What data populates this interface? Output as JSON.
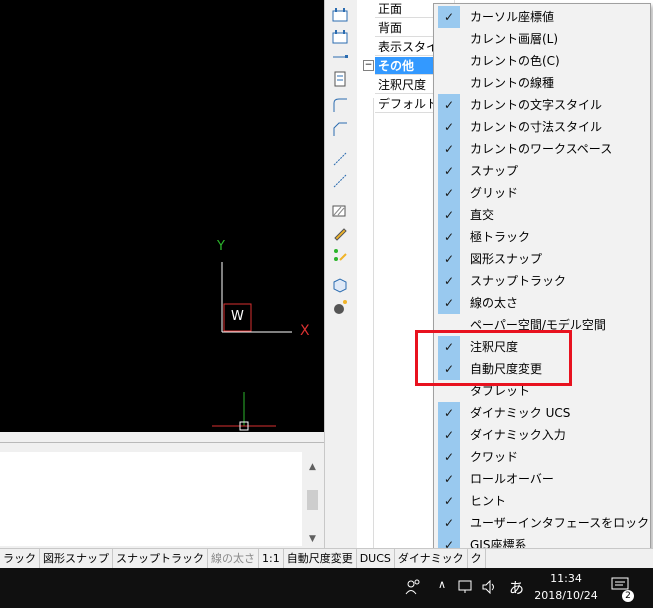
{
  "properties": {
    "rows": [
      "正面",
      "背面",
      "表示スタイル",
      "その他",
      "注釈尺度",
      "デフォルトの"
    ],
    "collapse_symbol": "⊟"
  },
  "canvas": {
    "axis_y_label": "Y",
    "axis_x_label": "X",
    "ucs_label": "W"
  },
  "context_menu": {
    "items": [
      {
        "label": "カーソル座標値",
        "checked": true
      },
      {
        "label": "カレント画層(L)",
        "checked": false
      },
      {
        "label": "カレントの色(C)",
        "checked": false
      },
      {
        "label": "カレントの線種",
        "checked": false
      },
      {
        "label": "カレントの文字スタイル",
        "checked": true
      },
      {
        "label": "カレントの寸法スタイル",
        "checked": true
      },
      {
        "label": "カレントのワークスペース",
        "checked": true
      },
      {
        "label": "スナップ",
        "checked": true
      },
      {
        "label": "グリッド",
        "checked": true
      },
      {
        "label": "直交",
        "checked": true
      },
      {
        "label": "極トラック",
        "checked": true
      },
      {
        "label": "図形スナップ",
        "checked": true
      },
      {
        "label": "スナップトラック",
        "checked": true
      },
      {
        "label": "線の太さ",
        "checked": true
      },
      {
        "label": "ペーパー空間/モデル空間",
        "checked": false
      },
      {
        "label": "注釈尺度",
        "checked": true
      },
      {
        "label": "自動尺度変更",
        "checked": true
      },
      {
        "label": "タブレット",
        "checked": false
      },
      {
        "label": "ダイナミック UCS",
        "checked": true
      },
      {
        "label": "ダイナミック入力",
        "checked": true
      },
      {
        "label": "クワッド",
        "checked": true
      },
      {
        "label": "ロールオーバー",
        "checked": true
      },
      {
        "label": "ヒント",
        "checked": true
      },
      {
        "label": "ユーザーインタフェースをロック",
        "checked": true
      },
      {
        "label": "GIS座標系",
        "checked": true
      }
    ],
    "check_glyph": "✓"
  },
  "statusbar": {
    "items": [
      "ラック",
      "図形スナップ",
      "スナップトラック",
      "線の太さ",
      "1:1",
      "自動尺度変更",
      "DUCS",
      "ダイナミック",
      "ク"
    ]
  },
  "taskbar": {
    "ime": "あ",
    "time": "11:34",
    "date": "2018/10/24",
    "notifications": "2"
  },
  "colors": {
    "highlight_box": "#e8121f",
    "check_bg": "#99c9ef",
    "selected_row": "#3399ff",
    "canvas_bg": "#000000"
  }
}
